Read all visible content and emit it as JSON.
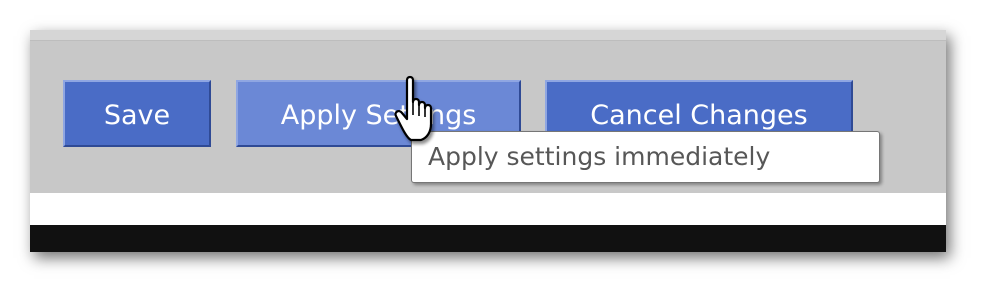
{
  "toolbar": {
    "save_label": "Save",
    "apply_label": "Apply Settings",
    "cancel_label": "Cancel Changes"
  },
  "tooltip": {
    "text": "Apply settings immediately"
  },
  "cursor": {
    "icon": "hand-pointer-icon"
  },
  "colors": {
    "button_bg": "#4a6cc6",
    "button_hover_bg": "#6b88d6",
    "toolbar_bg": "#c8c8c8",
    "tooltip_bg": "#ffffff",
    "tooltip_text": "#575757"
  }
}
